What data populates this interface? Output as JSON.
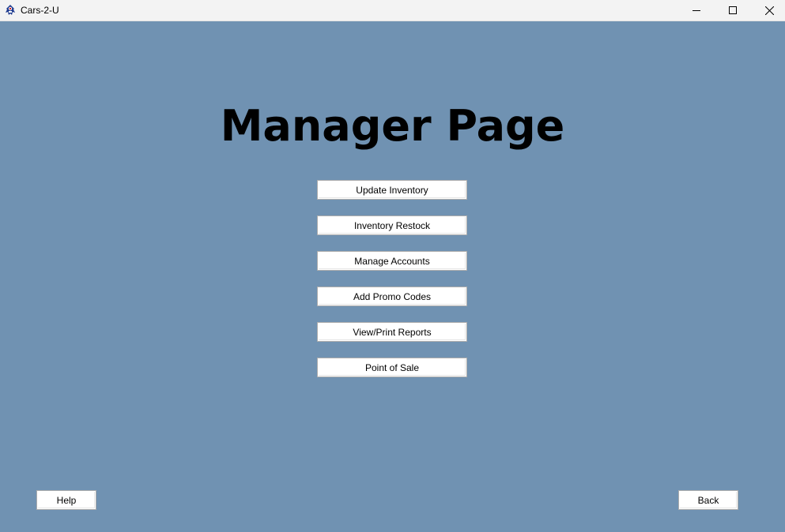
{
  "window": {
    "title": "Cars-2-U",
    "app_icon": "java-duke-icon",
    "controls": {
      "minimize_icon": "minimize-icon",
      "maximize_icon": "maximize-icon",
      "close_icon": "close-icon"
    }
  },
  "page": {
    "title": "Manager Page",
    "background_color": "#7092b2"
  },
  "menu": {
    "buttons": [
      {
        "label": "Update Inventory"
      },
      {
        "label": "Inventory Restock"
      },
      {
        "label": "Manage Accounts"
      },
      {
        "label": "Add Promo Codes"
      },
      {
        "label": "View/Print Reports"
      },
      {
        "label": "Point of Sale"
      }
    ]
  },
  "footer": {
    "help_label": "Help",
    "back_label": "Back"
  }
}
